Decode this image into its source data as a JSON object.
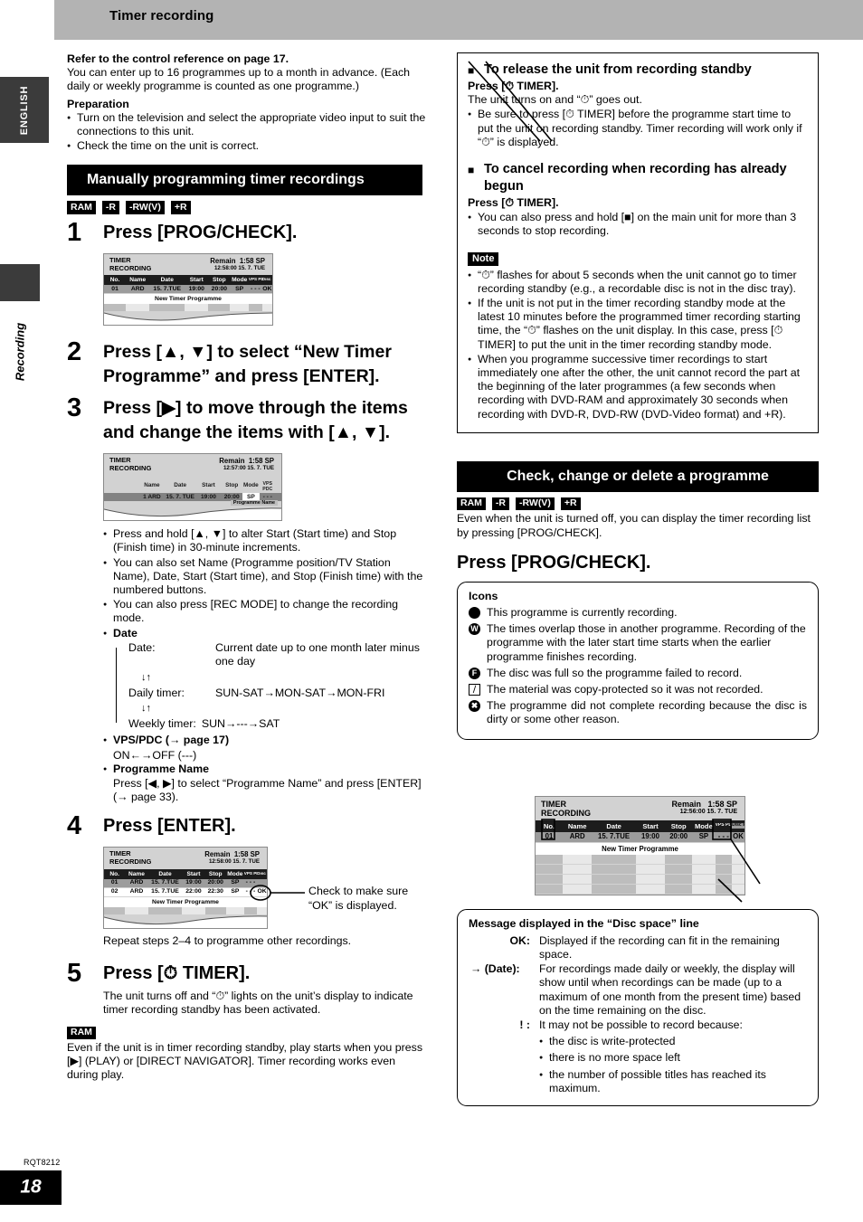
{
  "header": {
    "title": "Timer recording"
  },
  "rail": {
    "language": "ENGLISH",
    "section": "Recording"
  },
  "footer": {
    "code": "RQT8212",
    "page": "18"
  },
  "left": {
    "intro_bold": "Refer to the control reference on page 17.",
    "intro_body": "You can enter up to 16 programmes up to a month in advance. (Each daily or weekly programme is counted as one programme.)",
    "preparation_label": "Preparation",
    "preparation_items": [
      "Turn on the television and select the appropriate video input to suit the connections to this unit.",
      "Check the time on the unit is correct."
    ],
    "section_title": "Manually programming timer recordings",
    "badges": [
      "RAM",
      "-R",
      "-RW(V)",
      "+R"
    ],
    "steps": [
      {
        "num": "1",
        "text": "Press [PROG/CHECK]."
      },
      {
        "num": "2",
        "text": "Press [▲, ▼] to select “New Timer Programme” and press [ENTER]."
      },
      {
        "num": "3",
        "text": "Press [▶] to move through the items and change the items with [▲, ▼]."
      },
      {
        "num": "4",
        "text": "Press [ENTER]."
      },
      {
        "num": "5",
        "text": "Press [⏱ TIMER]."
      }
    ],
    "step3_notes": [
      "Press and hold [▲, ▼] to alter Start (Start time) and Stop (Finish time) in 30-minute increments.",
      "You can also set Name (Programme position/TV Station Name), Date, Start (Start time), and Stop (Finish time) with the numbered buttons.",
      "You can also press [REC MODE] to change the recording mode."
    ],
    "date_heading": "Date",
    "date_flow": {
      "rows": [
        {
          "label": "Date:",
          "value": "Current date up to one month later minus one day"
        },
        {
          "label": "Daily timer:",
          "value": "SUN-SAT→MON-SAT→MON-FRI"
        },
        {
          "label": "Weekly timer:",
          "value": "SUN→---→SAT"
        }
      ],
      "arrows": "↓↑"
    },
    "vps_heading": "VPS/PDC (→ page 17)",
    "vps_value": "ON←→OFF (---)",
    "progname_heading": "Programme Name",
    "progname_body": "Press [◀, ▶] to select “Programme Name” and press [ENTER] (→ page 33).",
    "step4_callout": "Check to make sure “OK” is displayed.",
    "repeat_note": "Repeat steps 2–4 to programme other recordings.",
    "step5_body": "The unit turns off and “⏱” lights on the unit’s display to indicate timer recording standby has been activated.",
    "ram_badge": "RAM",
    "ram_note": "Even if the unit is in timer recording standby, play starts when you press [▶] (PLAY) or [DIRECT NAVIGATOR]. Timer recording works even during play."
  },
  "osd": {
    "title_line1": "TIMER",
    "title_line2": "RECORDING",
    "remain_label": "Remain",
    "remain_value": "1:58  SP",
    "new_timer_row": "New Timer Programme",
    "columns": [
      "No.",
      "Name",
      "Date",
      "Start",
      "Stop",
      "Mode",
      "VPS PDC",
      "Disc space"
    ],
    "screen1": {
      "clock": "12:58:00   15. 7.  TUE",
      "rows": [
        [
          "01",
          "ARD",
          "15. 7.TUE",
          "19:00",
          "20:00",
          "SP",
          "- - -",
          "OK"
        ]
      ]
    },
    "screen3": {
      "clock": "12:57:00   15. 7.  TUE",
      "columns": [
        "Name",
        "Date",
        "Start",
        "Stop",
        "Mode",
        "VPS PDC"
      ],
      "row": [
        "1 ARD",
        "15. 7. TUE",
        "19:00",
        "20:00",
        "SP",
        "- - -"
      ],
      "tab_label": "Programme Name"
    },
    "screen4": {
      "clock": "12:58:00   15. 7.  TUE",
      "rows": [
        [
          "01",
          "ARD",
          "15. 7.TUE",
          "19:00",
          "20:00",
          "SP",
          "- - -",
          ""
        ],
        [
          "02",
          "ARD",
          "15. 7.TUE",
          "22:00",
          "22:30",
          "SP",
          "- - -",
          "OK"
        ]
      ]
    },
    "screen5": {
      "clock": "12:56:00   15. 7.  TUE",
      "rows": [
        [
          "01",
          "ARD",
          "15. 7.TUE",
          "19:00",
          "20:00",
          "SP",
          "- - -",
          "OK"
        ]
      ]
    }
  },
  "right": {
    "release_heading": "To release the unit from recording standby",
    "release_press": "Press [⏱ TIMER].",
    "release_body": "The unit turns on and “⏱” goes out.",
    "release_bullet": "Be sure to press [⏱ TIMER] before the programme start time to put the unit on recording standby. Timer recording will work only if “⏱” is displayed.",
    "cancel_heading": "To cancel recording when recording has already begun",
    "cancel_press": "Press [⏱ TIMER].",
    "cancel_bullet": "You can also press and hold [■] on the main unit for more than 3 seconds to stop recording.",
    "note_label": "Note",
    "notes": [
      "“⏱” flashes for about 5 seconds when the unit cannot go to timer recording standby (e.g., a recordable disc is not in the disc tray).",
      "If the unit is not put in the timer recording standby mode at the latest 10 minutes before the programmed timer recording starting time, the “⏱” flashes on the unit display. In this case, press [⏱ TIMER] to put the unit in the timer recording standby mode.",
      "When you programme successive timer recordings to start immediately one after the other, the unit cannot record the part at the beginning of the later programmes (a few seconds when recording with DVD-RAM and approximately 30 seconds when recording with DVD-R, DVD-RW (DVD-Video format) and +R)."
    ],
    "section_title": "Check, change or delete a programme",
    "badges": [
      "RAM",
      "-R",
      "-RW(V)",
      "+R"
    ],
    "section_body": "Even when the unit is turned off, you can display the timer recording list by pressing [PROG/CHECK].",
    "press_heading": "Press [PROG/CHECK].",
    "icons_label": "Icons",
    "icons": [
      {
        "glyph": "●",
        "kind": "dot",
        "text": "This programme is currently recording."
      },
      {
        "glyph": "W",
        "kind": "circle",
        "text": "The times overlap those in another programme. Recording of the programme with the later start time starts when the earlier programme finishes recording."
      },
      {
        "glyph": "F",
        "kind": "circle",
        "text": "The disc was full so the programme failed to record."
      },
      {
        "glyph": "⧸",
        "kind": "sq",
        "text": "The material was copy-protected so it was not recorded."
      },
      {
        "glyph": "✖",
        "kind": "circle",
        "text": "The programme did not complete recording because the disc is dirty or some other reason."
      }
    ],
    "msg_title": "Message displayed in the “Disc space” line",
    "messages": [
      {
        "key": "OK:",
        "text": "Displayed if the recording can fit in the remaining space."
      },
      {
        "key": "→ (Date):",
        "text": "For recordings made daily or weekly, the display will show until when recordings can be made (up to a maximum of one month from the present time) based on the time remaining on the disc."
      },
      {
        "key": "! :",
        "text": "It may not be possible to record because:",
        "subs": [
          "the disc is write-protected",
          "there is no more space left",
          "the number of possible titles has reached its maximum."
        ]
      }
    ]
  }
}
